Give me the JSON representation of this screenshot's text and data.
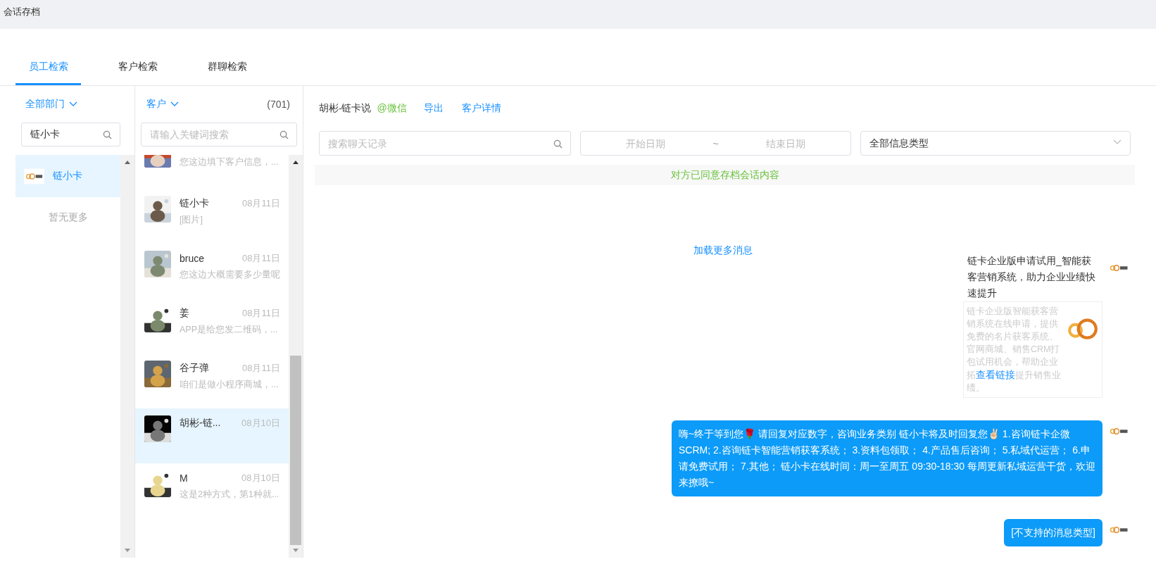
{
  "page_title": "会话存档",
  "tabs": [
    {
      "label": "员工检索",
      "selected": true
    },
    {
      "label": "客户检索",
      "selected": false
    },
    {
      "label": "群聊检索",
      "selected": false
    }
  ],
  "staff_panel": {
    "department": "全部部门",
    "search_value": "链小卡",
    "items": [
      {
        "name": "链小卡",
        "selected": true
      }
    ],
    "empty_text": "暂无更多"
  },
  "customer_panel": {
    "filter": "客户",
    "count": "(701)",
    "search_placeholder": "请输入关键词搜索",
    "items": [
      {
        "preview": "您这边填下客户信息，...",
        "selected": false,
        "clipped": true
      },
      {
        "name": "链小卡",
        "time": "08月11日",
        "preview": "[图片]",
        "selected": false
      },
      {
        "name": "bruce",
        "time": "08月11日",
        "preview": "您这边大概需要多少量呢",
        "selected": false
      },
      {
        "name": "姜",
        "time": "08月11日",
        "preview": "APP是给您发二维码，...",
        "selected": false
      },
      {
        "name": "谷子弹",
        "time": "08月11日",
        "preview": "咱们是做小程序商城，...",
        "selected": false
      },
      {
        "name": "胡彬-链...",
        "time": "08月10日",
        "selected": true
      },
      {
        "name": "M",
        "time": "08月10日",
        "preview": "这是2种方式，第1种就...",
        "selected": false
      }
    ]
  },
  "chat": {
    "contact": "胡彬-链卡说",
    "source": "@微信",
    "actions": [
      "导出",
      "客户详情"
    ],
    "search_placeholder": "搜索聊天记录",
    "start_placeholder": "开始日期",
    "range_sep": "~",
    "end_placeholder": "结束日期",
    "type_value": "全部信息类型",
    "notice": "对方已同意存档会话内容",
    "load_more": "加载更多消息",
    "messages": [
      {
        "kind": "link",
        "title": "链卡企业版申请试用_智能获客营销系统，助力企业业绩快速提升",
        "desc_before": "链卡企业版智能获客营销系统在线申请，提供免费的名片获客系统、官网商城、销售CRM打包试用机会，帮助企业拓",
        "link": "查看链接",
        "desc_after": "提升销售业绩。"
      },
      {
        "kind": "text",
        "text": "嗨~终于等到您🌹 请回复对应数字，咨询业务类别 链小卡将及时回复您✌🏻 1.咨询链卡企微SCRM; 2.咨询链卡智能营销获客系统； 3.资料包领取； 4.产品售后咨询； 5.私域代运营； 6.申请免费试用； 7.其他； 链小卡在线时间：周一至周五 09:30-18:30 每周更新私域运营干货，欢迎来撩哦~"
      },
      {
        "kind": "text",
        "text": "[不支持的消息类型]"
      }
    ]
  }
}
